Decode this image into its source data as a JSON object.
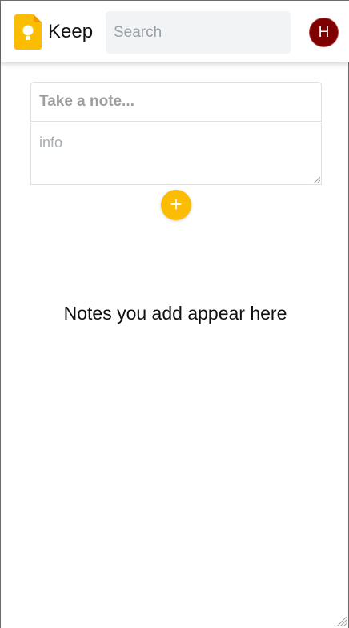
{
  "header": {
    "app_title": "Keep",
    "logo_icon": "keep-lightbulb-icon",
    "search_placeholder": "Search",
    "avatar_initial": "H",
    "avatar_color": "#7f0000"
  },
  "composer": {
    "title_placeholder": "Take a note...",
    "body_placeholder": "info",
    "add_button_label": "+",
    "add_button_icon": "plus-icon",
    "accent_color": "#fbbc04"
  },
  "main": {
    "empty_message": "Notes you add appear here"
  }
}
